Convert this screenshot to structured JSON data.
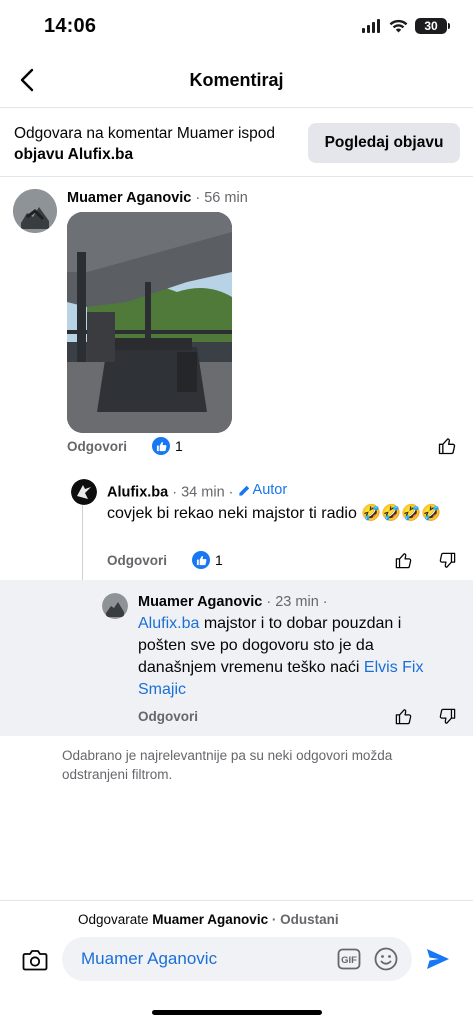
{
  "status_bar": {
    "time": "14:06",
    "battery": "30"
  },
  "header": {
    "title": "Komentiraj"
  },
  "reply_context": {
    "text_prefix": "Odgovara na komentar Muamer ispod ",
    "text_bold": "objavu Alufix.ba",
    "view_post_label": "Pogledaj objavu"
  },
  "comments": [
    {
      "author": "Muamer Aganovic",
      "time": " · 56 min",
      "reply_label": "Odgovori",
      "like_count": "1"
    },
    {
      "author": "Alufix.ba",
      "time": " · 34 min · ",
      "badge": "Autor",
      "text": "covjek bi rekao neki majstor ti radio 🤣🤣🤣🤣",
      "reply_label": "Odgovori",
      "like_count": "1"
    },
    {
      "author": "Muamer Aganovic",
      "time": " · 23 min ·",
      "mention1": "Alufix.ba",
      "text": " majstor i to dobar pouzdan i pošten sve po dogovoru sto je da današnjem vremenu teško naći ",
      "mention2": "Elvis Fix Smajic",
      "reply_label": "Odgovori"
    }
  ],
  "filter_note": "Odabrano je najrelevantnije pa su neki odgovori možda odstranjeni filtrom.",
  "composer": {
    "replying_prefix": "Odgovarate ",
    "replying_name": "Muamer Aganovic",
    "cancel_label": " · Odustani",
    "input_value": "Muamer Aganovic"
  },
  "colors": {
    "accent": "#1877f2",
    "muted": "#65676b",
    "highlight": "#eff1f4"
  },
  "icons": [
    "back-chevron-icon",
    "signal-icon",
    "wifi-icon",
    "battery-icon",
    "like-reaction-icon",
    "thumbs-up-icon",
    "thumbs-down-icon",
    "pencil-icon",
    "camera-icon",
    "gif-icon",
    "emoji-icon",
    "send-icon"
  ]
}
